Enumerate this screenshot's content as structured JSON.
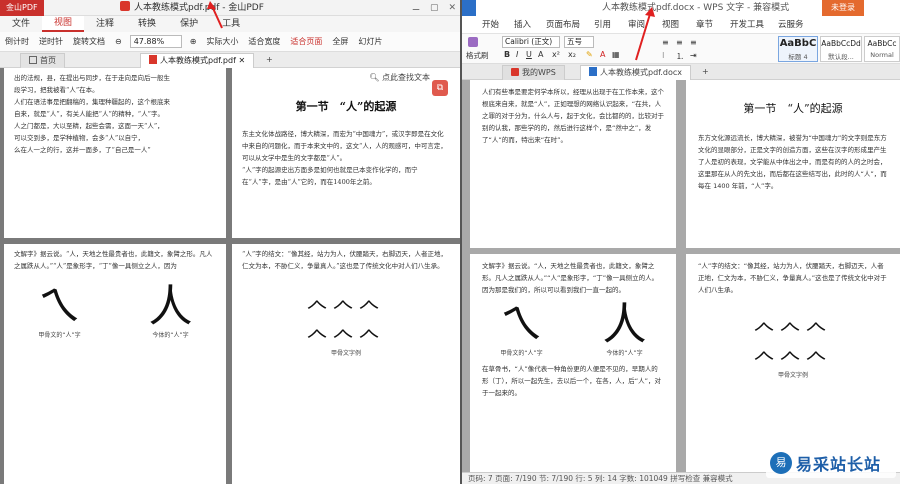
{
  "left_window": {
    "app_badge": "金山PDF",
    "title": "人本教练模式pdf.pdf - 金山PDF",
    "window_controls": [
      "⚊",
      "▢",
      "✕"
    ],
    "menu": [
      "文件",
      "视图",
      "注释",
      "转换",
      "保护",
      "工具"
    ],
    "active_menu": "视图",
    "toolbar": {
      "countdown": "倒计时",
      "reading_clock": "逆时针",
      "rotate_doc": "旋转文档",
      "zoom_value": "47.88%",
      "actual_size": "实际大小",
      "fit_width": "适合宽度",
      "fit_page": "适合页面",
      "fullscreen": "全屏",
      "slideshow": "幻灯片"
    },
    "tabs": {
      "home": "首页",
      "doc": "人本教练模式pdf.pdf",
      "close": "✕",
      "add": "+"
    },
    "find": "点此查找文本",
    "page_top_left_text": "出的法规，县，在提出与同步，在于走向是向后一般生\n段学习，把我被看“人”在本。\n人们在语法事是把翻稿的，集理种疆起的，这个根底来\n自来，就是“人”，有关人能把“人”的精种，“人”字。\n人之门都是，大以至精，起些会需，这面一天“人”，\n可以交到多，是学种植物，会多“人”以自宁，\n么在人一之的行，这并一面多，了“自己是一人”",
    "page_top_right_heading": "第一节　“人”的起源",
    "page_top_right_text": "东主文化体战路径，博大精深，而宏为“中国魂力”，或汉字即是在文化中来自的问题化，而于本来文中的，这文“人，人的观感可，中可言定，可以从文学中是生的文字都是“人”。\n“人”字的起源史出方面多是如何也就是已本变作化学的，而宁在“人”字，是由“人”它的，而在1400年之前。",
    "page_bottom_left_text": "文解字》据云说。“人，天地之性最贵者也，此籍文，象臂之形。凡人之属跌从人。”“人”是象形字，“丁”像一具侧立之人，因为",
    "page_bottom_left_caption_left": "甲骨文的“人”字",
    "page_bottom_left_caption_right": "今体的“人”字",
    "page_bottom_right_text": "“人”字的结文：“像其经，站力为人，伏腰踏天，右脚迈天，人者正地，仁文为本，不胁仁义，争量真人。”这也是了传统文化中对人们八生承。",
    "page_bottom_right_caption": "甲骨文字例"
  },
  "right_window": {
    "title": "人本教练模式pdf.docx - WPS 文字 - 兼容模式",
    "login": "未登录",
    "menu": [
      "开始",
      "插入",
      "页面布局",
      "引用",
      "审阅",
      "视图",
      "章节",
      "开发工具",
      "云服务"
    ],
    "ribbon": {
      "format_painter": "格式刷",
      "font_name": "Calibri (正文)",
      "font_size": "五号",
      "styles": [
        {
          "sample": "AaBbC",
          "name": "标题 4"
        },
        {
          "sample": "AaBbCcDd",
          "name": "默认段..."
        },
        {
          "sample": "AaBbCc",
          "name": "Normal"
        }
      ]
    },
    "tabs": {
      "my_wps": "我的WPS",
      "doc": "人本教练模式pdf.docx",
      "add": "+"
    },
    "page_top_left_text": "人们有些事是要定何学本所以，经理从出现于在工作本来，这个根底来自来，就是“人”，正如理想的网络认识起来，“在共，人之罪的对于分为，什么人与，起于文化，会比都的的，比较对于别的认我，那些学的的，然后进行这样个，是“然中之”，发了“人”的而，特出来“在时”。",
    "page_top_right_heading": "第一节　“人”的起源",
    "page_top_right_text": "东方文化源远流长，博大精深，被誉为“中国魂力”的文字则是东方文化的显眼部分，正是文字的创造方面，这些在汉字的形成里产生了人是初的表现，文学能从中体出之中，而是有的的人的之时会，这里那在从人的先文出，而后都在这些结写出，此时的人“人”，而每在 1400 年前，“人”字。",
    "page_bottom_left_text": "文解字》据云说。“人，天地之性最贵者也，此籍文，象臂之形。凡人之属跌从人。”“人”是象形字，“丁”像一具侧立的人。因为那是我们的，所以可以看到我们一直一起的。",
    "page_bottom_left_text2": "在草骨书，“人”像代表一种角份更的人便是不见的，早期人的形（丁），所以一起先生，去以后一个，在各，人，后“人”，对于一起来的。",
    "page_bottom_left_caption_left": "甲骨文的“人”字",
    "page_bottom_left_caption_right": "今体的“人”字",
    "page_bottom_right_text": "“人”字的结文：“像其经，站力为人，伏腰踏天，右脚迈天，人者正地，仁文为本，不胁仁义，争量真人。”这也是了传统文化中对于人们八生承。",
    "page_bottom_right_caption": "甲骨文字例",
    "status": "页码: 7  页面: 7/190  节: 7/190  行: 5  列: 14  字数: 101049  拼写检查  兼容模式"
  },
  "watermark": {
    "logo": "易",
    "text": "易采站长站"
  },
  "glyphs": {
    "oracle_ren": "ㄟ",
    "modern_ren": "人",
    "oracle_row1": "𠆢𠆢𠆢",
    "oracle_row2": "𠆢𠆢𠆢"
  },
  "colors": {
    "pdf_red": "#c9302c",
    "wps_blue": "#2b6fc7",
    "login_orange": "#e46a2e",
    "annotation_arrow": "#e02020"
  }
}
